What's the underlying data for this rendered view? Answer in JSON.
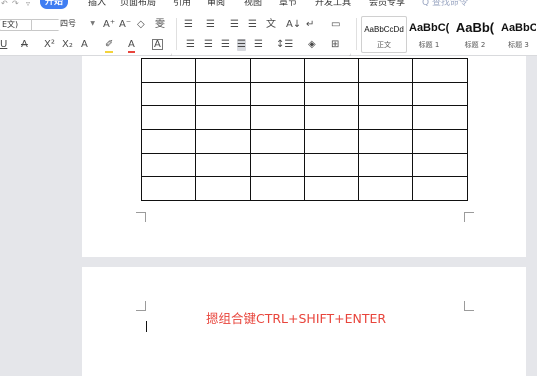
{
  "menubar": {
    "quick_access": [
      "↶",
      "↷",
      "▿"
    ],
    "items": [
      {
        "label": "开始",
        "active": true
      },
      {
        "label": "插入"
      },
      {
        "label": "页面布局"
      },
      {
        "label": "引用"
      },
      {
        "label": "审阅"
      },
      {
        "label": "视图"
      },
      {
        "label": "章节"
      },
      {
        "label": "开发工具"
      },
      {
        "label": "会员专享"
      }
    ],
    "search_placeholder": "Q 查找命令"
  },
  "ribbon": {
    "font_name": "E文)",
    "font_size": "四号",
    "grow_font": "A⁺",
    "shrink_font": "A⁻",
    "clear_format": "◇",
    "phonetic": "雯",
    "underline": "U",
    "strike_color": "A",
    "superscript": "X²",
    "subscript": "X₂",
    "text_effect": "A",
    "highlight": "✐",
    "font_color": "A",
    "char_border": "A",
    "bullets": "☰",
    "numbering": "☰",
    "decrease_indent": "☰",
    "increase_indent": "☰",
    "chinese_layout": "文",
    "sort": "A↓",
    "show_marks": "↵",
    "char_scale": "▭",
    "align_left": "☰",
    "align_center": "☰",
    "align_right": "☰",
    "justify": "☰",
    "distributed": "☰",
    "line_spacing": "↕☰",
    "shading": "◈",
    "borders": "⊞",
    "styles": [
      {
        "sample": "AaBbCcDd",
        "name": "正文",
        "selected": true
      },
      {
        "sample": "AaBbC(",
        "name": "标题 1"
      },
      {
        "sample": "AaBb(",
        "name": "标题 2"
      },
      {
        "sample": "AaBbC",
        "name": "标题 3"
      }
    ]
  },
  "document": {
    "table": {
      "rows": 6,
      "cols": 6
    },
    "page2_text": "摁组合键CTRL+SHIFT+ENTER"
  }
}
